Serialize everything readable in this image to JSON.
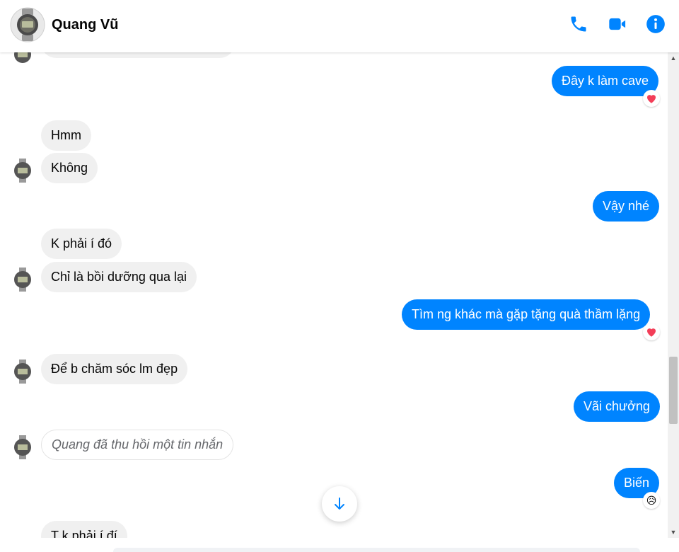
{
  "header": {
    "contact_name": "Quang Vũ",
    "icons": [
      "phone-icon",
      "video-call-icon",
      "info-icon"
    ],
    "accent_color": "#0084ff"
  },
  "messages": {
    "m1": "Đây k làm cave",
    "m2": "Hmm",
    "m3": "Không",
    "m4": "Vậy nhé",
    "m5": "K phải í đó",
    "m6": "Chỉ là bồi dưỡng qua lại",
    "m7": "Tìm ng khác mà gặp tặng quà thầm lặng",
    "m8": "Để b chăm sóc lm đẹp",
    "m9": "Vãi chưởng",
    "m10": "Quang đã thu hồi một tin nhắn",
    "m11": "Biến",
    "m12": "T k phải í đí"
  },
  "reactions": {
    "m1": "heart",
    "m7": "heart",
    "m11": "😥"
  },
  "colors": {
    "incoming_bubble": "#f0f0f0",
    "outgoing_bubble": "#0084ff",
    "heart": "#f33e58"
  }
}
